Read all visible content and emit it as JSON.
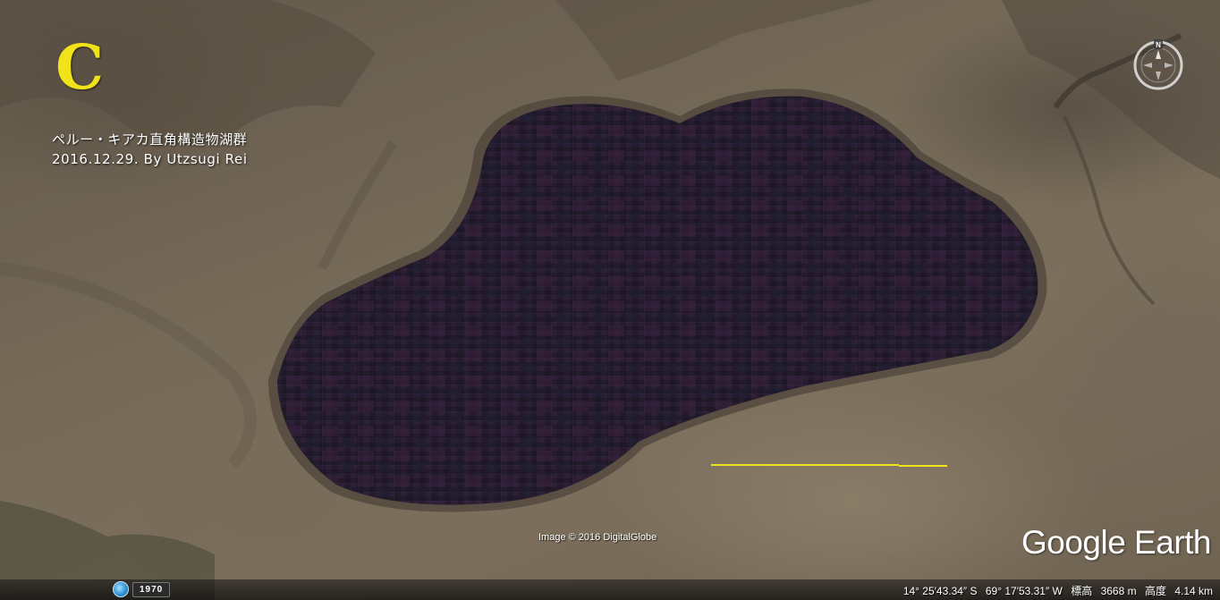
{
  "overlay": {
    "letter": "C",
    "caption_line1": "ペルー・キアカ直角構造物湖群",
    "caption_line2": "2016.12.29. By Utzsugi Rei",
    "line_color": "#f2e21a"
  },
  "imagery": {
    "copyright": "Image © 2016 DigitalGlobe",
    "brand": "Google Earth"
  },
  "compass": {
    "north_label": "N"
  },
  "historical": {
    "year": "1970",
    "icon": "historical-imagery-icon"
  },
  "status": {
    "latitude": "14° 25′43.34″ S",
    "longitude": "69° 17′53.31″ W",
    "elevation_label": "標高",
    "elevation_value": "3668 m",
    "eye_alt_label": "高度",
    "eye_alt_value": "4.14 km"
  }
}
